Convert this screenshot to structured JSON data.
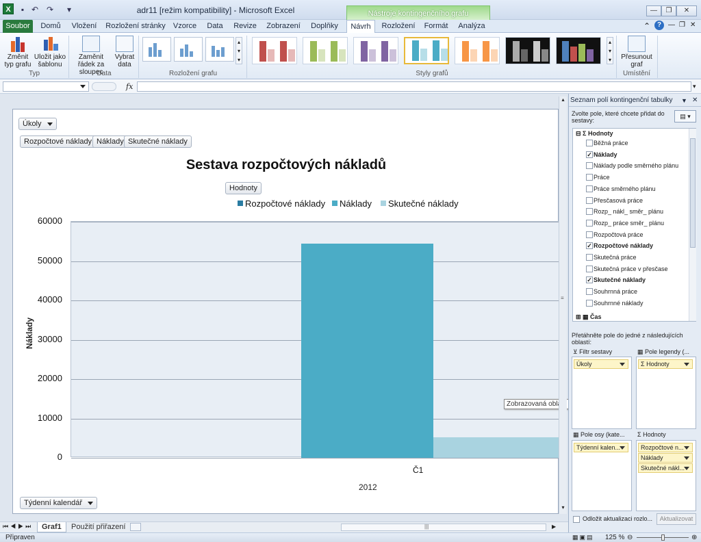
{
  "window": {
    "title": "adr11  [režim kompatibility] - Microsoft Excel",
    "context_group": "Nástroje kontingenčního grafu",
    "minimize_glyph": "—",
    "restore_glyph": "❐",
    "close_glyph": "✕"
  },
  "tabs": [
    "Soubor",
    "Domů",
    "Vložení",
    "Rozložení stránky",
    "Vzorce",
    "Data",
    "Revize",
    "Zobrazení",
    "Doplňky",
    "Návrh",
    "Rozložení",
    "Formát",
    "Analýza"
  ],
  "ribbon": {
    "change_type": "Změnit typ grafu",
    "save_template": "Uložit jako šablonu",
    "switch_row": "Zaměnit řádek za sloupec",
    "select_data": "Vybrat data",
    "move_chart": "Přesunout graf",
    "groups": {
      "type": "Typ",
      "data": "Data",
      "layout": "Rozložení grafu",
      "styles": "Styly grafů",
      "location": "Umístění"
    }
  },
  "formula_bar": {
    "fx": "fx",
    "value": ""
  },
  "chart": {
    "filter_button": "Úkoly",
    "legend_field_buttons": [
      "Rozpočtové náklady",
      "Náklady",
      "Skutečné náklady"
    ],
    "values_button": "Hodnoty",
    "axis_field_button": "Týdenní kalendář",
    "tooltip": "Zobrazovaná oblast"
  },
  "chart_data": {
    "type": "bar",
    "title": "Sestava rozpočtových nákladů",
    "ylabel": "Náklady",
    "xlabel": "",
    "categories": [
      "Č1"
    ],
    "category_group": "2012",
    "ylim": [
      0,
      60000
    ],
    "yticks": [
      0,
      10000,
      20000,
      30000,
      40000,
      50000,
      60000
    ],
    "grid": true,
    "legend_position": "top",
    "series": [
      {
        "name": "Rozpočtové náklady",
        "color": "#2a7ca2",
        "values": [
          0
        ]
      },
      {
        "name": "Náklady",
        "color": "#4bacc6",
        "values": [
          54500
        ]
      },
      {
        "name": "Skutečné náklady",
        "color": "#a9d3e0",
        "values": [
          5200
        ]
      }
    ]
  },
  "sheets": [
    "Graf1",
    "Použití přiřazení"
  ],
  "status": {
    "ready": "Připraven",
    "zoom": "125 %"
  },
  "panel": {
    "title": "Seznam polí kontingenční tabulky",
    "instruction": "Zvolte pole, které chcete přidat do sestavy:",
    "values_group": "Hodnoty",
    "time_group": "Čas",
    "fields": [
      {
        "label": "Běžná práce",
        "checked": false
      },
      {
        "label": "Náklady",
        "checked": true
      },
      {
        "label": "Náklady podle směrného plánu",
        "checked": false
      },
      {
        "label": "Práce",
        "checked": false
      },
      {
        "label": "Práce směrného plánu",
        "checked": false
      },
      {
        "label": "Přesčasová práce",
        "checked": false
      },
      {
        "label": "Rozp_ nákl_ směr_ plánu",
        "checked": false
      },
      {
        "label": "Rozp_ práce směr_ plánu",
        "checked": false
      },
      {
        "label": "Rozpočtová práce",
        "checked": false
      },
      {
        "label": "Rozpočtové náklady",
        "checked": true
      },
      {
        "label": "Skutečná práce",
        "checked": false
      },
      {
        "label": "Skutečná práce v přesčase",
        "checked": false
      },
      {
        "label": "Skutečné náklady",
        "checked": true
      },
      {
        "label": "Souhrnná práce",
        "checked": false
      },
      {
        "label": "Souhrnné náklady",
        "checked": false
      }
    ],
    "drag_hint": "Přetáhněte pole do jedné z následujících oblastí:",
    "zone_filter": "Filtr sestavy",
    "zone_legend": "Pole legendy (...",
    "zone_axis": "Pole osy (kate...",
    "zone_values": "Hodnoty",
    "filter_items": [
      "Úkoly"
    ],
    "legend_items": [
      "Hodnoty"
    ],
    "axis_items": [
      "Týdenní kalen..."
    ],
    "value_items": [
      "Rozpočtové n...",
      "Náklady",
      "Skutečné nákl..."
    ],
    "defer_label": "Odložit aktualizaci rozlo...",
    "update_button": "Aktualizovat"
  }
}
